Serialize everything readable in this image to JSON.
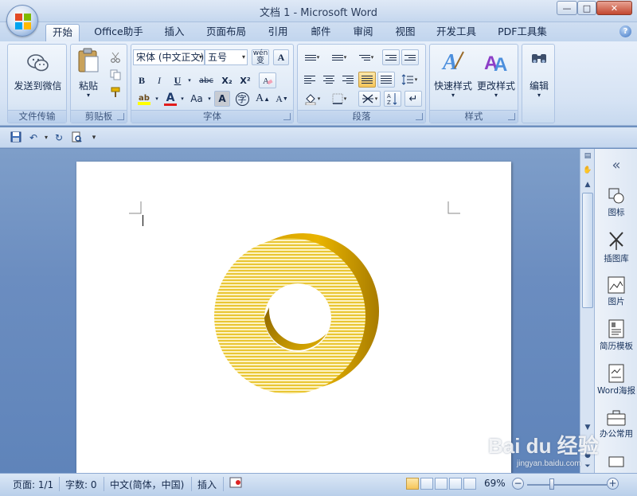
{
  "window": {
    "title": "文档 1 - Microsoft Word",
    "minimize": "—",
    "maximize": "□",
    "close": "✕"
  },
  "tabs": [
    {
      "label": "开始",
      "active": true
    },
    {
      "label": "Office助手"
    },
    {
      "label": "插入"
    },
    {
      "label": "页面布局"
    },
    {
      "label": "引用"
    },
    {
      "label": "邮件"
    },
    {
      "label": "审阅"
    },
    {
      "label": "视图"
    },
    {
      "label": "开发工具"
    },
    {
      "label": "PDF工具集"
    }
  ],
  "help_icon": "?",
  "ribbon": {
    "groups": {
      "wenjian": "文件传输",
      "jiantieban": "剪贴板",
      "ziti": "字体",
      "duanluo": "段落",
      "yangshi": "样式"
    },
    "send_wechat": "发送到微信",
    "paste": "粘贴",
    "font_name": "宋体 (中文正文)",
    "font_size": "五号",
    "wen_label": "wén",
    "wen_char": "变",
    "A_label": "A",
    "bold": "B",
    "italic": "I",
    "underline": "U",
    "strike": "abc",
    "subscript": "X₂",
    "superscript": "X²",
    "font_color": "A",
    "change_case": "Aa",
    "char_shade": "A",
    "enclose": "字",
    "grow_font": "A",
    "shrink_font": "A",
    "quick_styles": "快速样式",
    "change_styles": "更改样式",
    "edit": "编辑"
  },
  "statusbar": {
    "page": "页面: 1/1",
    "words": "字数: 0",
    "lang": "中文(简体，中国)",
    "mode": "插入",
    "zoom": "69%",
    "zoom_minus": "−",
    "zoom_plus": "+"
  },
  "right_pane": {
    "collapse": "«",
    "items": [
      "图标",
      "插图库",
      "图片",
      "简历模板",
      "Word海报",
      "办公常用"
    ]
  },
  "watermark": {
    "brand": "Bai du 经验",
    "url": "jingyan.baidu.com"
  },
  "colors": {
    "ring_gold": "#e8b800",
    "ring_light": "#f4e07a",
    "ring_shadow": "#b88a00",
    "ribbon_bg": "#dbe7f5",
    "accent_blue": "#3f76c4"
  }
}
